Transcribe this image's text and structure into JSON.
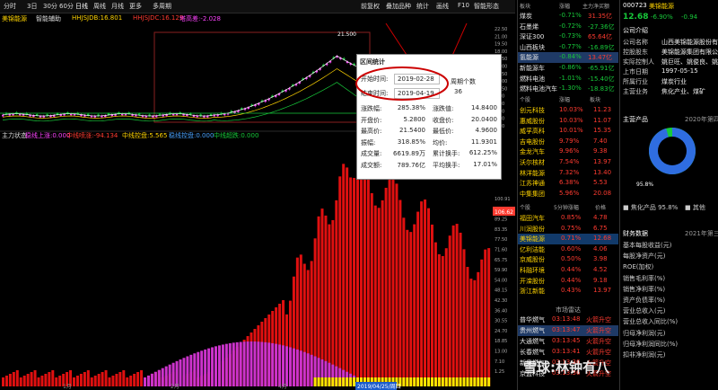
{
  "toolbar": {
    "items": [
      "分时",
      "3日",
      "30分",
      "60分",
      "日线",
      "周线",
      "月线",
      "更多",
      "多周期"
    ],
    "right_items": [
      "前复权",
      "叠加品种",
      "统计",
      "画线",
      "F10",
      "智能形态"
    ]
  },
  "indicators": {
    "left_label": "美锦能源",
    "smart": "智能辅助",
    "hhjs": "HHJSJDB:16.801",
    "hhjsc": "HHJSJDC:16.129",
    "rise": "塔高差:-2.028"
  },
  "sub_indicators": {
    "label": "主力状态",
    "a": "稳线上涨:0.000",
    "b": "中线喷涨:-94.134",
    "c": "中线控盘:5.565",
    "d": "稳线控盘:0.000",
    "e": "中线超跌:0.000"
  },
  "chart_annotations": {
    "high": "21.500",
    "price_right": "106.62",
    "date_label": "2019/04/25/周四",
    "x_month_1": "1月",
    "x_month_2": "2月",
    "x_month_3": "4月",
    "y_ticks": [
      "22.50",
      "21.00",
      "19.50",
      "18.00",
      "16.50",
      "15.00",
      "13.50",
      "12.00",
      "10.50",
      "9.00",
      "7.50",
      "6.00",
      "4.50",
      "3.00"
    ],
    "y_ticks_lower": [
      "100.91",
      "95.00",
      "89.25",
      "83.35",
      "77.50",
      "71.60",
      "65.75",
      "59.90",
      "54.00",
      "48.15",
      "42.30",
      "36.40",
      "30.55",
      "24.70",
      "18.85",
      "13.00",
      "7.10",
      "1.25"
    ],
    "watermark": "雪球:林钟有八"
  },
  "dialog": {
    "title": "区间统计",
    "start_label": "开始时间:",
    "start_value": "2019-02-28",
    "end_label": "结束时间:",
    "end_value": "2019-04-19",
    "period_label": "周期个数",
    "period_value": "36",
    "stats": [
      [
        "涨跌幅:",
        "285.38%",
        "涨跌值:",
        "14.8400"
      ],
      [
        "开盘价:",
        "5.2800",
        "收盘价:",
        "20.0400"
      ],
      [
        "最高价:",
        "21.5400",
        "最低价:",
        "4.9600"
      ],
      [
        "振幅:",
        "318.85%",
        "均价:",
        "11.9301"
      ],
      [
        "成交量:",
        "6619.89万",
        "累计换手:",
        "612.25%"
      ],
      [
        "成交额:",
        "789.76亿",
        "平均换手:",
        "17.01%"
      ]
    ]
  },
  "right_panel": {
    "header": [
      "板块",
      "涨幅",
      "主力净买额"
    ],
    "sectors": [
      [
        "煤炭",
        "-0.71%",
        "31.35亿"
      ],
      [
        "石墨烯",
        "-0.72%",
        "-27.36亿"
      ],
      [
        "深证300",
        "-0.73%",
        "65.64亿"
      ],
      [
        "山西板块",
        "-0.77%",
        "-16.89亿"
      ],
      [
        "氢能源",
        "-0.84%",
        "13.47亿"
      ],
      [
        "新能源车",
        "-0.86%",
        "-65.91亿"
      ],
      [
        "燃料电池",
        "-1.01%",
        "-15.40亿"
      ],
      [
        "燃料电池汽车",
        "-1.30%",
        "-18.83亿"
      ]
    ],
    "sub_header": [
      "个股",
      "涨幅",
      "板块"
    ],
    "stocks": [
      [
        "创元科技",
        "10.03%",
        "11.23"
      ],
      [
        "惠威股份",
        "10.03%",
        "11.07"
      ],
      [
        "威孚高科",
        "10.01%",
        "15.35"
      ],
      [
        "吉电股份",
        "9.79%",
        "7.40"
      ],
      [
        "金龙汽车",
        "9.96%",
        "9.38"
      ],
      [
        "沃尔核材",
        "7.54%",
        "13.97"
      ],
      [
        "林洋能源",
        "7.32%",
        "13.40"
      ],
      [
        "江苏神通",
        "6.38%",
        "5.53"
      ],
      [
        "中集集团",
        "5.96%",
        "20.08"
      ]
    ],
    "sub_header2": [
      "个股",
      "5分钟涨幅",
      "价格"
    ],
    "stocks2": [
      [
        "福田汽车",
        "0.85%",
        "4.78"
      ],
      [
        "川润股份",
        "0.75%",
        "6.75"
      ],
      [
        "美锦能源",
        "0.71%",
        "12.68"
      ],
      [
        "亿利洁能",
        "0.60%",
        "4.06"
      ],
      [
        "京威股份",
        "0.50%",
        "3.98"
      ],
      [
        "科融环境",
        "0.44%",
        "4.52"
      ],
      [
        "开滦股份",
        "0.44%",
        "9.18"
      ],
      [
        "浙江新能",
        "0.43%",
        "13.97"
      ]
    ],
    "radar_title": "市场雷达",
    "radar": [
      [
        "普华燃气",
        "03:13:48",
        "火箭升空"
      ],
      [
        "贵州燃气",
        "03:13:47",
        "火箭升空"
      ],
      [
        "大通燃气",
        "03:13:45",
        "火箭升空"
      ],
      [
        "长春燃气",
        "03:13:41",
        "火箭升空"
      ],
      [
        "新奥燃气",
        "03:13:36",
        "火箭升空"
      ],
      [
        "京蓝科技",
        "03:13:36",
        "火箭升空"
      ]
    ]
  },
  "fund_panel": {
    "code": "000723",
    "name": "美锦能源",
    "price": "12.68",
    "change_pct": "-6.90%",
    "change": "-0.94",
    "company_title": "公司介绍",
    "fields": [
      [
        "公司名称",
        "山西美锦能源股份有限"
      ],
      [
        "控股股东",
        "美锦能源集团有限公司"
      ],
      [
        "实际控制人",
        "姚巨旺、姚俊良、姚"
      ],
      [
        "上市日期",
        "1997-05-15"
      ],
      [
        "所属行业",
        "煤炭行业"
      ],
      [
        "主营业务",
        "焦化产业、煤矿"
      ]
    ],
    "product_title": "主营产品",
    "product_year": "2020年第四",
    "pie_pct": "95.8%",
    "legend": [
      [
        "焦化产品",
        "95.8%"
      ],
      [
        "其他",
        ""
      ]
    ],
    "finance_title": "财务数据",
    "finance_year": "2021年第三",
    "finance_rows": [
      "基本每股收益(元)",
      "每股净资产(元)",
      "ROE(加权)",
      "销售毛利率(%)",
      "销售净利率(%)",
      "资产负债率(%)",
      "营业总收入(元)",
      "营业总收入同比(%)",
      "归母净利润(元)",
      "归母净利润同比(%)",
      "扣非净利润(元)"
    ]
  },
  "colors": {
    "up": "#ff2b2b",
    "down": "#17c93a",
    "magenta": "#ff44ff",
    "yellow": "#ffe600",
    "accent": "#ffd400"
  }
}
